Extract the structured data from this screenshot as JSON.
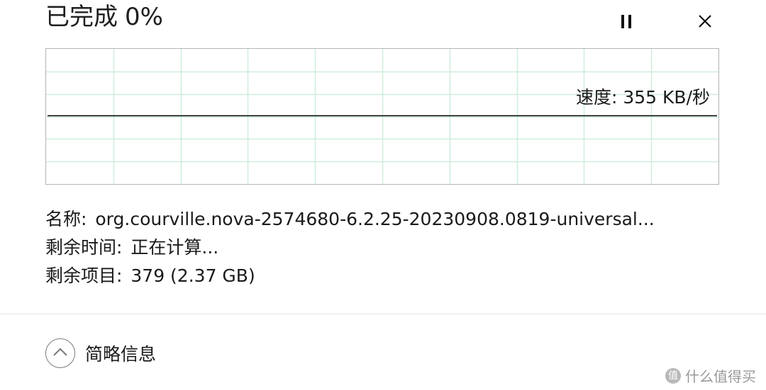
{
  "dialog": {
    "title_status": "已完成",
    "title_percent": "0%",
    "progress_fraction": 0.0
  },
  "controls": {
    "pause_icon": "pause-icon",
    "close_icon": "close-icon"
  },
  "graph": {
    "speed_label": "速度: 355 KB/秒",
    "grid_color": "#cfeedb",
    "line_color": "#000000",
    "speed_line_fraction": 0.5
  },
  "info": {
    "name_label": "名称:",
    "name_value": "org.courville.nova-2574680-6.2.25-20230908.0819-universal...",
    "time_label": "剩余时间:",
    "time_value": "正在计算...",
    "items_label": "剩余项目:",
    "items_value": "379 (2.37 GB)"
  },
  "footer": {
    "toggle_icon": "chevron-up-circle-icon",
    "toggle_label": "简略信息"
  },
  "watermark": {
    "icon_text": "值",
    "text": "什么值得买"
  }
}
